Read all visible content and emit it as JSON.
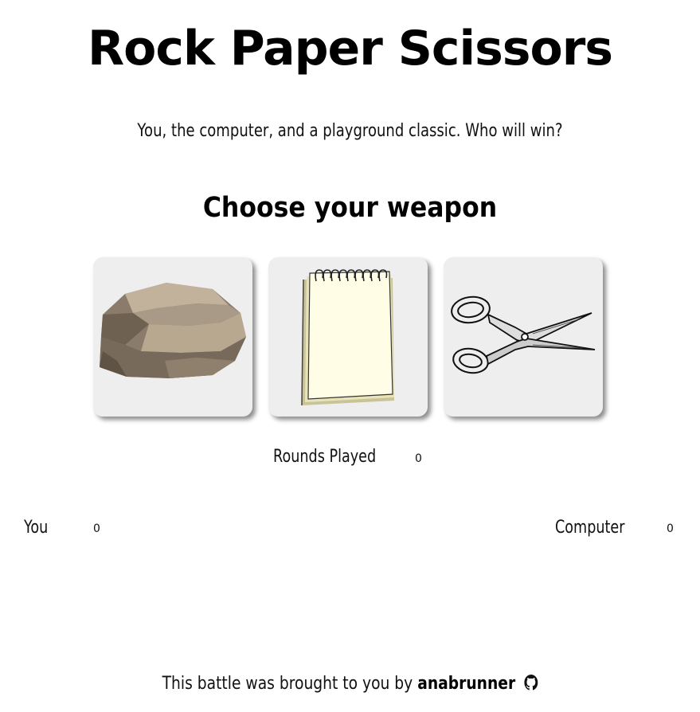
{
  "header": {
    "title": "Rock Paper Scissors",
    "subtitle": "You, the computer, and a playground classic. Who will win?"
  },
  "game": {
    "choose_heading": "Choose your weapon",
    "weapons": [
      {
        "id": "rock",
        "icon": "rock-icon"
      },
      {
        "id": "paper",
        "icon": "notepad-icon"
      },
      {
        "id": "scissors",
        "icon": "scissors-icon"
      }
    ],
    "rounds_label": "Rounds Played",
    "rounds_value": "0"
  },
  "score": {
    "you_label": "You",
    "you_value": "0",
    "computer_label": "Computer",
    "computer_value": "0"
  },
  "footer": {
    "text": "This battle was brought to you by",
    "author": "anabrunner",
    "icon": "github-icon"
  },
  "colors": {
    "card_bg": "#eeeeee",
    "text": "#111111"
  }
}
